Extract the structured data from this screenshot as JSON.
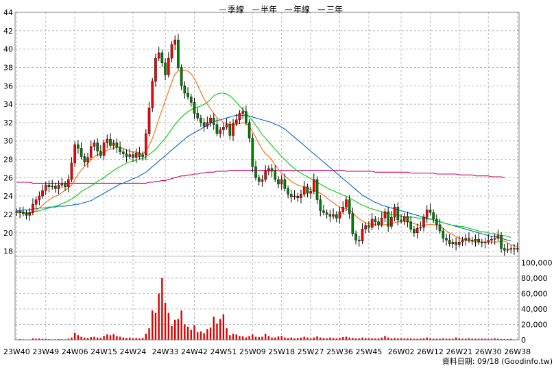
{
  "chart_data": [
    {
      "type": "candlestick",
      "legend": [
        {
          "name": "季線",
          "color": "#ff6600"
        },
        {
          "name": "半年",
          "color": "#00cc00"
        },
        {
          "name": "年線",
          "color": "#0066cc"
        },
        {
          "name": "三年",
          "color": "#cc0066"
        }
      ],
      "colors": {
        "up": "#ff0000",
        "down": "#008000"
      },
      "ylim": [
        17,
        44
      ],
      "y_ticks": [
        18,
        20,
        22,
        24,
        26,
        28,
        30,
        32,
        34,
        36,
        38,
        40,
        42,
        44
      ],
      "grid": true,
      "x_tick_labels": [
        "23W40",
        "23W49",
        "24W06",
        "24W15",
        "24W24",
        "24W33",
        "24W42",
        "24W51",
        "25W09",
        "25W18",
        "25W27",
        "25W36",
        "25W45",
        "26W02",
        "26W12",
        "26W21",
        "26W30",
        "26W38"
      ],
      "weeks_count": 156,
      "close": [
        22.3,
        22.2,
        22.1,
        21.9,
        22.2,
        23.1,
        23.6,
        24.0,
        24.6,
        25.2,
        25.0,
        25.1,
        24.8,
        25.2,
        25.3,
        25.0,
        25.8,
        27.6,
        29.6,
        29.2,
        28.3,
        27.7,
        28.2,
        29.4,
        29.8,
        28.9,
        28.4,
        29.8,
        30.2,
        29.5,
        29.8,
        29.3,
        28.8,
        28.6,
        28.3,
        28.5,
        28.2,
        28.7,
        28.3,
        28.5,
        30.8,
        33.6,
        36.5,
        39.0,
        39.6,
        38.5,
        37.2,
        39.0,
        40.5,
        41.0,
        38.0,
        36.0,
        35.2,
        34.8,
        34.2,
        33.0,
        32.5,
        32.0,
        31.6,
        32.0,
        32.5,
        31.8,
        30.8,
        31.2,
        31.5,
        31.8,
        30.6,
        31.9,
        32.3,
        33.0,
        33.2,
        32.0,
        30.3,
        27.2,
        26.0,
        25.6,
        25.8,
        26.7,
        27.0,
        26.7,
        25.8,
        25.3,
        25.8,
        24.8,
        24.2,
        23.9,
        24.0,
        23.8,
        24.2,
        25.0,
        24.3,
        24.5,
        25.8,
        23.6,
        22.4,
        22.2,
        22.0,
        21.8,
        22.0,
        21.6,
        22.3,
        22.8,
        23.6,
        22.1,
        19.9,
        19.2,
        19.1,
        20.4,
        20.8,
        20.6,
        21.5,
        21.2,
        20.9,
        21.6,
        22.3,
        20.7,
        21.7,
        22.8,
        21.4,
        21.3,
        21.8,
        21.2,
        20.4,
        20.0,
        20.5,
        20.6,
        21.7,
        22.5,
        22.2,
        21.5,
        20.9,
        20.2,
        19.4,
        19.2,
        18.8,
        19.0,
        18.7,
        19.0,
        19.2,
        19.4,
        19.2,
        19.1,
        19.3,
        19.0,
        18.9,
        19.0,
        19.2,
        19.3,
        19.4,
        19.7,
        18.3,
        18.1,
        18.2,
        18.3,
        18.2,
        18.3
      ],
      "ma_quarter": [
        22.2,
        22.2,
        22.2,
        22.1,
        22.1,
        22.2,
        22.4,
        22.7,
        23.0,
        23.3,
        23.6,
        23.8,
        24.0,
        24.1,
        24.4,
        24.6,
        24.9,
        25.2,
        25.8,
        26.4,
        26.8,
        27.2,
        27.6,
        27.9,
        28.3,
        28.5,
        28.6,
        28.8,
        29.0,
        29.1,
        29.2,
        29.3,
        29.3,
        29.2,
        29.0,
        28.9,
        28.8,
        28.8,
        28.7,
        28.6,
        28.9,
        29.5,
        30.3,
        31.3,
        32.4,
        33.4,
        34.4,
        35.4,
        36.4,
        37.3,
        37.6,
        37.7,
        37.7,
        37.6,
        37.3,
        36.8,
        36.1,
        35.3,
        34.6,
        34.0,
        33.5,
        33.0,
        32.5,
        32.3,
        32.0,
        31.9,
        31.8,
        31.8,
        31.8,
        31.9,
        32.0,
        31.9,
        31.6,
        31.0,
        30.4,
        29.7,
        29.1,
        28.6,
        28.3,
        27.9,
        27.4,
        26.9,
        26.5,
        26.2,
        25.9,
        25.6,
        25.4,
        25.2,
        25.1,
        25.0,
        24.9,
        24.7,
        24.6,
        24.5,
        24.3,
        24.1,
        23.8,
        23.5,
        23.3,
        23.0,
        22.8,
        22.7,
        22.6,
        22.5,
        22.2,
        21.8,
        21.5,
        21.3,
        21.1,
        21.0,
        20.9,
        20.9,
        20.8,
        20.8,
        20.9,
        20.9,
        21.0,
        21.1,
        21.2,
        21.2,
        21.2,
        21.2,
        21.1,
        21.0,
        20.9,
        20.8,
        20.8,
        20.9,
        20.9,
        20.9,
        20.8,
        20.7,
        20.5,
        20.2,
        20.0,
        19.8,
        19.6,
        19.4,
        19.3,
        19.2,
        19.1,
        19.1,
        19.0,
        19.0,
        19.0,
        19.0,
        19.0,
        19.0,
        19.0,
        19.0,
        19.1,
        19.1,
        18.9,
        18.7,
        18.6,
        18.5
      ],
      "ma_half": [
        22.3,
        22.3,
        22.3,
        22.2,
        22.2,
        22.3,
        22.3,
        22.4,
        22.5,
        22.6,
        22.7,
        22.8,
        22.9,
        23.0,
        23.2,
        23.3,
        23.5,
        23.7,
        23.9,
        24.2,
        24.5,
        24.7,
        24.9,
        25.1,
        25.3,
        25.6,
        25.8,
        26.0,
        26.3,
        26.5,
        26.8,
        27.0,
        27.2,
        27.4,
        27.6,
        27.7,
        27.8,
        27.9,
        28.0,
        28.1,
        28.3,
        28.5,
        28.8,
        29.1,
        29.5,
        29.9,
        30.3,
        30.8,
        31.3,
        31.8,
        32.2,
        32.6,
        32.9,
        33.2,
        33.4,
        33.6,
        33.7,
        33.8,
        34.0,
        34.2,
        34.5,
        34.9,
        35.1,
        35.2,
        35.2,
        35.1,
        34.9,
        34.6,
        34.2,
        33.8,
        33.4,
        33.0,
        32.6,
        32.2,
        31.7,
        31.2,
        30.7,
        30.3,
        29.9,
        29.5,
        29.1,
        28.7,
        28.3,
        28.0,
        27.6,
        27.3,
        27.0,
        26.7,
        26.5,
        26.3,
        26.1,
        25.9,
        25.7,
        25.5,
        25.3,
        25.1,
        24.9,
        24.7,
        24.6,
        24.4,
        24.3,
        24.1,
        24.0,
        23.8,
        23.6,
        23.4,
        23.2,
        23.0,
        22.9,
        22.7,
        22.6,
        22.5,
        22.4,
        22.3,
        22.2,
        22.1,
        22.0,
        22.0,
        21.9,
        21.8,
        21.7,
        21.7,
        21.7,
        21.7,
        21.6,
        21.6,
        21.6,
        21.5,
        21.5,
        21.4,
        21.3,
        21.2,
        21.1,
        21.0,
        20.9,
        20.8,
        20.8,
        20.7,
        20.7,
        20.6,
        20.5,
        20.4,
        20.3,
        20.2,
        20.1,
        20.1,
        20.0,
        19.9,
        19.9,
        19.8,
        19.7,
        19.7,
        19.6,
        19.5
      ],
      "ma_year": [
        22.4,
        22.4,
        22.5,
        22.5,
        22.5,
        22.6,
        22.6,
        22.7,
        22.7,
        22.7,
        22.8,
        22.8,
        22.8,
        22.9,
        22.9,
        22.9,
        23.0,
        23.0,
        23.1,
        23.1,
        23.2,
        23.3,
        23.4,
        23.5,
        23.7,
        23.9,
        24.1,
        24.3,
        24.5,
        24.7,
        24.9,
        25.1,
        25.3,
        25.4,
        25.6,
        25.7,
        25.9,
        26.0,
        26.2,
        26.4,
        26.6,
        26.9,
        27.2,
        27.5,
        27.8,
        28.1,
        28.4,
        28.7,
        29.0,
        29.3,
        29.6,
        29.9,
        30.2,
        30.5,
        30.7,
        30.9,
        31.1,
        31.3,
        31.5,
        31.7,
        31.9,
        32.1,
        32.2,
        32.3,
        32.4,
        32.5,
        32.6,
        32.7,
        32.8,
        32.8,
        32.8,
        32.8,
        32.7,
        32.6,
        32.5,
        32.4,
        32.3,
        32.2,
        32.1,
        32.0,
        31.8,
        31.7,
        31.5,
        31.3,
        31.0,
        30.7,
        30.4,
        30.1,
        29.8,
        29.5,
        29.2,
        28.9,
        28.6,
        28.3,
        28.0,
        27.7,
        27.4,
        27.1,
        26.8,
        26.5,
        26.2,
        25.9,
        25.6,
        25.3,
        25.0,
        24.7,
        24.4,
        24.1,
        23.9,
        23.7,
        23.5,
        23.3,
        23.2,
        23.0,
        22.9,
        22.8,
        22.7,
        22.6,
        22.5,
        22.4,
        22.3,
        22.2,
        22.1,
        22.0,
        21.9,
        21.8,
        21.7,
        21.6,
        21.5,
        21.4,
        21.3,
        21.2,
        21.1,
        21.0,
        20.9,
        20.8,
        20.7,
        20.6,
        20.5,
        20.4,
        20.3,
        20.2,
        20.1,
        20.0,
        19.9,
        19.8,
        19.7,
        19.6,
        19.6,
        19.5,
        19.4,
        19.3,
        19.2,
        19.1
      ],
      "ma_3year": [
        25.5,
        25.5,
        25.5,
        25.5,
        25.5,
        25.4,
        25.4,
        25.4,
        25.4,
        25.4,
        25.4,
        25.4,
        25.4,
        25.4,
        25.4,
        25.4,
        25.4,
        25.4,
        25.4,
        25.4,
        25.4,
        25.4,
        25.4,
        25.4,
        25.4,
        25.4,
        25.4,
        25.4,
        25.4,
        25.4,
        25.4,
        25.4,
        25.4,
        25.4,
        25.4,
        25.4,
        25.4,
        25.4,
        25.4,
        25.4,
        25.4,
        25.5,
        25.5,
        25.6,
        25.6,
        25.7,
        25.7,
        25.8,
        25.9,
        26.0,
        26.1,
        26.2,
        26.2,
        26.3,
        26.3,
        26.4,
        26.4,
        26.5,
        26.5,
        26.6,
        26.6,
        26.6,
        26.7,
        26.7,
        26.7,
        26.7,
        26.8,
        26.8,
        26.8,
        26.8,
        26.8,
        26.8,
        26.8,
        26.8,
        26.8,
        26.8,
        26.8,
        26.8,
        26.8,
        26.8,
        26.8,
        26.8,
        26.8,
        26.8,
        26.8,
        26.8,
        26.8,
        26.8,
        26.8,
        26.8,
        26.8,
        26.8,
        26.8,
        26.8,
        26.8,
        26.8,
        26.8,
        26.8,
        26.8,
        26.8,
        26.8,
        26.8,
        26.7,
        26.7,
        26.7,
        26.7,
        26.7,
        26.7,
        26.7,
        26.7,
        26.7,
        26.6,
        26.6,
        26.6,
        26.6,
        26.6,
        26.6,
        26.6,
        26.6,
        26.6,
        26.6,
        26.6,
        26.5,
        26.5,
        26.5,
        26.5,
        26.5,
        26.5,
        26.5,
        26.5,
        26.4,
        26.4,
        26.4,
        26.4,
        26.4,
        26.4,
        26.4,
        26.3,
        26.3,
        26.3,
        26.3,
        26.3,
        26.2,
        26.2,
        26.2,
        26.2,
        26.2,
        26.1,
        26.1,
        26.1,
        26.1,
        26.0
      ]
    },
    {
      "type": "bar",
      "y_ticks": [
        "100,000",
        "80,000",
        "60,000",
        "40,000",
        "20,000",
        "0"
      ],
      "y_tick_values": [
        100000,
        80000,
        60000,
        40000,
        20000,
        0
      ],
      "ylim": [
        0,
        110000
      ],
      "color": "#dd0000",
      "values": [
        500,
        800,
        600,
        500,
        400,
        2000,
        1500,
        1800,
        1200,
        1000,
        800,
        600,
        700,
        900,
        800,
        600,
        1500,
        3000,
        9000,
        6000,
        4000,
        3000,
        2500,
        3500,
        4000,
        3000,
        2500,
        5000,
        7000,
        6000,
        7500,
        5000,
        4000,
        3000,
        2500,
        3000,
        2000,
        2500,
        2000,
        2500,
        8000,
        15000,
        38000,
        35000,
        60000,
        80000,
        48000,
        35000,
        18000,
        26000,
        27000,
        38000,
        20000,
        17000,
        13000,
        19000,
        10000,
        11000,
        8500,
        14000,
        16000,
        30000,
        21000,
        27000,
        33000,
        15000,
        6000,
        8000,
        7000,
        5000,
        4500,
        3000,
        5000,
        7000,
        4000,
        3500,
        4000,
        8000,
        5000,
        3000,
        3000,
        4500,
        5000,
        3000,
        2500,
        3000,
        2000,
        2500,
        3000,
        4000,
        3000,
        2000,
        3000,
        4500,
        3000,
        2500,
        2000,
        3000,
        2500,
        2000,
        2500,
        3500,
        4000,
        3000,
        2500,
        2000,
        2000,
        3000,
        2500,
        2000,
        2000,
        2000,
        2000,
        3000,
        5000,
        3000,
        2000,
        2500,
        2000,
        2000,
        1800,
        2000,
        2000,
        1500,
        1500,
        1800,
        2000,
        3000,
        2000,
        1500,
        1500,
        1500,
        2000,
        1500,
        1500,
        1500,
        3000,
        2000,
        1500,
        1500,
        2000,
        1500,
        1500,
        1500,
        1500,
        1500,
        1200,
        1500,
        2000,
        1500,
        1000,
        1000,
        1000,
        1200
      ]
    }
  ],
  "source_note": "資料日期: 09/18  (Goodinfo.tw)"
}
